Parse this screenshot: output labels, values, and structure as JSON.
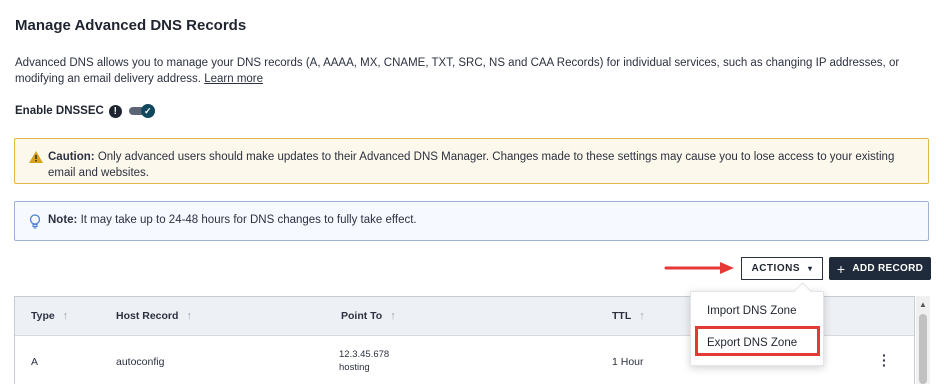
{
  "page": {
    "title": "Manage Advanced DNS Records",
    "description": "Advanced DNS allows you to manage your DNS records (A, AAAA, MX, CNAME, TXT, SRC, NS and CAA Records) for individual services, such as changing IP addresses, or modifying an email delivery address.",
    "learn_more": "Learn more"
  },
  "dnssec": {
    "label": "Enable DNSSEC",
    "info_icon": "exclamation-icon",
    "enabled": true
  },
  "caution": {
    "label": "Caution:",
    "text": " Only advanced users should make updates to their Advanced DNS Manager. Changes made to these settings may cause you to lose access to your existing email and websites.",
    "icon": "warning-triangle-icon",
    "border_color": "#e0b84a"
  },
  "note": {
    "label": "Note:",
    "text": " It may take up to 24-48 hours for DNS changes to fully take effect.",
    "icon": "lightbulb-icon"
  },
  "toolbar": {
    "actions_label": "ACTIONS",
    "add_record_label": "ADD RECORD"
  },
  "actions_menu": {
    "items": [
      {
        "label": "Import DNS Zone"
      },
      {
        "label": "Export DNS Zone"
      }
    ],
    "highlight_color": "#e53935"
  },
  "table": {
    "columns": [
      "Type",
      "Host Record",
      "Point To",
      "TTL"
    ],
    "rows": [
      {
        "type": "A",
        "host": "autoconfig",
        "point_to": "12.3.45.678",
        "point_to_sub": "hosting",
        "ttl": "1 Hour"
      }
    ]
  },
  "colors": {
    "primary_button": "#1f2a3a",
    "annotation_arrow": "#e53935",
    "toggle_on": "#11485e"
  }
}
